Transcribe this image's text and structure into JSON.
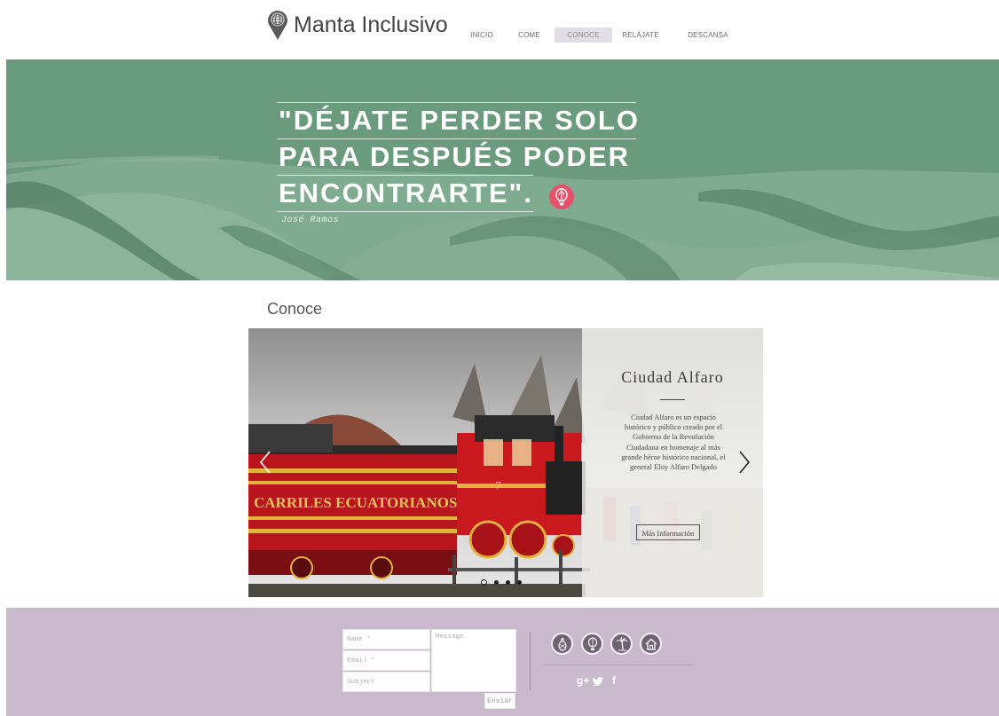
{
  "header": {
    "logo_text": "Manta Inclusivo",
    "nav": [
      {
        "label": "INICIO"
      },
      {
        "label": "COME"
      },
      {
        "label": "CONOCE"
      },
      {
        "label": "RELÁJATE"
      },
      {
        "label": "DESCANSA"
      }
    ],
    "active_index": 2
  },
  "hero": {
    "quote_lines": [
      "\"DÉJATE PERDER SOLO",
      "PARA DESPUÉS PODER",
      "ENCONTRARTE\"."
    ],
    "author": "José Ramos",
    "badge_icon": "hot-air-balloon-icon"
  },
  "section": {
    "title": "Conoce"
  },
  "slider": {
    "photo_text": "CARRILES ECUATORIANOS",
    "engine_number": "7",
    "title": "Ciudad Alfaro",
    "description": "Ciudad Alfaro es un espacio histórico y público creado por el Gobierno de la Revolución Ciudadana en homenaje al más grande héroe histórico nacional, el general Eloy Alfaro Delgado",
    "button_label": "Más Información",
    "slide_count": 5,
    "active_slide": 1
  },
  "footer": {
    "form": {
      "name_placeholder": "Name *",
      "email_placeholder": "Email *",
      "subject_placeholder": "Subject",
      "message_placeholder": "Message",
      "send_label": "Enviar"
    },
    "icons": [
      "pineapple-icon",
      "hot-air-balloon-icon",
      "palm-tree-icon",
      "house-icon"
    ],
    "social": {
      "google_plus": "g+",
      "twitter": "twitter-icon",
      "facebook": "f"
    }
  },
  "colors": {
    "hero_green": "#6b9b7d",
    "footer_lilac": "#c8b9cc",
    "nav_active": "#e3dde5",
    "badge_red": "#e9506a",
    "icon_circle": "#6e6273"
  }
}
